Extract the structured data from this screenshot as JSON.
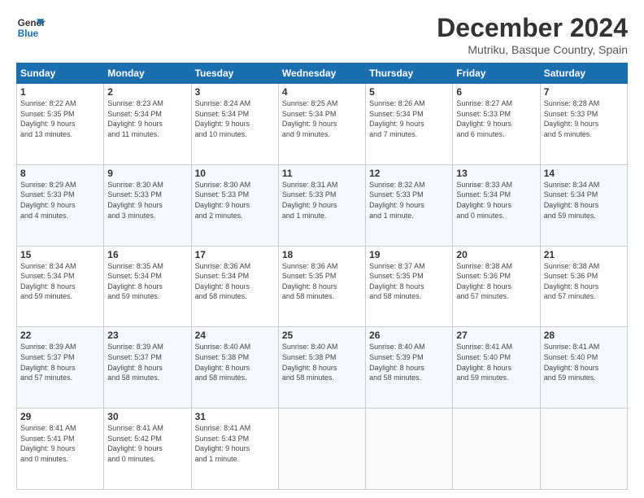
{
  "logo": {
    "text_line1": "General",
    "text_line2": "Blue"
  },
  "header": {
    "month": "December 2024",
    "location": "Mutriku, Basque Country, Spain"
  },
  "weekdays": [
    "Sunday",
    "Monday",
    "Tuesday",
    "Wednesday",
    "Thursday",
    "Friday",
    "Saturday"
  ],
  "weeks": [
    [
      {
        "day": "1",
        "info": "Sunrise: 8:22 AM\nSunset: 5:35 PM\nDaylight: 9 hours\nand 13 minutes."
      },
      {
        "day": "2",
        "info": "Sunrise: 8:23 AM\nSunset: 5:34 PM\nDaylight: 9 hours\nand 11 minutes."
      },
      {
        "day": "3",
        "info": "Sunrise: 8:24 AM\nSunset: 5:34 PM\nDaylight: 9 hours\nand 10 minutes."
      },
      {
        "day": "4",
        "info": "Sunrise: 8:25 AM\nSunset: 5:34 PM\nDaylight: 9 hours\nand 9 minutes."
      },
      {
        "day": "5",
        "info": "Sunrise: 8:26 AM\nSunset: 5:34 PM\nDaylight: 9 hours\nand 7 minutes."
      },
      {
        "day": "6",
        "info": "Sunrise: 8:27 AM\nSunset: 5:33 PM\nDaylight: 9 hours\nand 6 minutes."
      },
      {
        "day": "7",
        "info": "Sunrise: 8:28 AM\nSunset: 5:33 PM\nDaylight: 9 hours\nand 5 minutes."
      }
    ],
    [
      {
        "day": "8",
        "info": "Sunrise: 8:29 AM\nSunset: 5:33 PM\nDaylight: 9 hours\nand 4 minutes."
      },
      {
        "day": "9",
        "info": "Sunrise: 8:30 AM\nSunset: 5:33 PM\nDaylight: 9 hours\nand 3 minutes."
      },
      {
        "day": "10",
        "info": "Sunrise: 8:30 AM\nSunset: 5:33 PM\nDaylight: 9 hours\nand 2 minutes."
      },
      {
        "day": "11",
        "info": "Sunrise: 8:31 AM\nSunset: 5:33 PM\nDaylight: 9 hours\nand 1 minute."
      },
      {
        "day": "12",
        "info": "Sunrise: 8:32 AM\nSunset: 5:33 PM\nDaylight: 9 hours\nand 1 minute."
      },
      {
        "day": "13",
        "info": "Sunrise: 8:33 AM\nSunset: 5:34 PM\nDaylight: 9 hours\nand 0 minutes."
      },
      {
        "day": "14",
        "info": "Sunrise: 8:34 AM\nSunset: 5:34 PM\nDaylight: 8 hours\nand 59 minutes."
      }
    ],
    [
      {
        "day": "15",
        "info": "Sunrise: 8:34 AM\nSunset: 5:34 PM\nDaylight: 8 hours\nand 59 minutes."
      },
      {
        "day": "16",
        "info": "Sunrise: 8:35 AM\nSunset: 5:34 PM\nDaylight: 8 hours\nand 59 minutes."
      },
      {
        "day": "17",
        "info": "Sunrise: 8:36 AM\nSunset: 5:34 PM\nDaylight: 8 hours\nand 58 minutes."
      },
      {
        "day": "18",
        "info": "Sunrise: 8:36 AM\nSunset: 5:35 PM\nDaylight: 8 hours\nand 58 minutes."
      },
      {
        "day": "19",
        "info": "Sunrise: 8:37 AM\nSunset: 5:35 PM\nDaylight: 8 hours\nand 58 minutes."
      },
      {
        "day": "20",
        "info": "Sunrise: 8:38 AM\nSunset: 5:36 PM\nDaylight: 8 hours\nand 57 minutes."
      },
      {
        "day": "21",
        "info": "Sunrise: 8:38 AM\nSunset: 5:36 PM\nDaylight: 8 hours\nand 57 minutes."
      }
    ],
    [
      {
        "day": "22",
        "info": "Sunrise: 8:39 AM\nSunset: 5:37 PM\nDaylight: 8 hours\nand 57 minutes."
      },
      {
        "day": "23",
        "info": "Sunrise: 8:39 AM\nSunset: 5:37 PM\nDaylight: 8 hours\nand 58 minutes."
      },
      {
        "day": "24",
        "info": "Sunrise: 8:40 AM\nSunset: 5:38 PM\nDaylight: 8 hours\nand 58 minutes."
      },
      {
        "day": "25",
        "info": "Sunrise: 8:40 AM\nSunset: 5:38 PM\nDaylight: 8 hours\nand 58 minutes."
      },
      {
        "day": "26",
        "info": "Sunrise: 8:40 AM\nSunset: 5:39 PM\nDaylight: 8 hours\nand 58 minutes."
      },
      {
        "day": "27",
        "info": "Sunrise: 8:41 AM\nSunset: 5:40 PM\nDaylight: 8 hours\nand 59 minutes."
      },
      {
        "day": "28",
        "info": "Sunrise: 8:41 AM\nSunset: 5:40 PM\nDaylight: 8 hours\nand 59 minutes."
      }
    ],
    [
      {
        "day": "29",
        "info": "Sunrise: 8:41 AM\nSunset: 5:41 PM\nDaylight: 9 hours\nand 0 minutes."
      },
      {
        "day": "30",
        "info": "Sunrise: 8:41 AM\nSunset: 5:42 PM\nDaylight: 9 hours\nand 0 minutes."
      },
      {
        "day": "31",
        "info": "Sunrise: 8:41 AM\nSunset: 5:43 PM\nDaylight: 9 hours\nand 1 minute."
      },
      null,
      null,
      null,
      null
    ]
  ]
}
